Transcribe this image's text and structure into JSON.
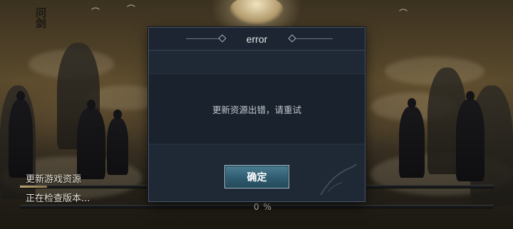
{
  "logo": {
    "text": "问剑"
  },
  "loading": {
    "update_label": "更新游戏资源",
    "status_label": "正在检查版本...",
    "progress_value": 0,
    "percent_text": "0 %"
  },
  "dialog": {
    "title": "error",
    "message": "更新资源出错，请重试",
    "confirm_label": "确定"
  },
  "colors": {
    "dialog_bg": "#1f2936",
    "button_accent": "#2f5c70",
    "progress_fill": "#b89e6c"
  }
}
